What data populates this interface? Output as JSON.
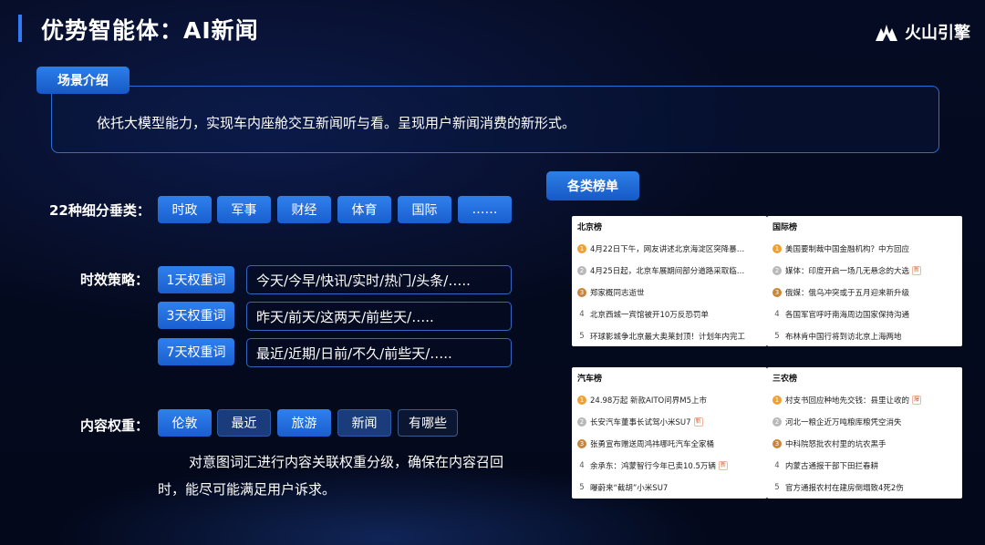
{
  "header": {
    "title": "优势智能体：AI新闻",
    "logo_text": "火山引擎"
  },
  "scene": {
    "tag": "场景介绍",
    "text": "依托大模型能力，实现车内座舱交互新闻听与看。呈现用户新闻消费的新形式。"
  },
  "categories": {
    "label": "22种细分垂类：",
    "items": [
      "时政",
      "军事",
      "财经",
      "体育",
      "国际",
      "……"
    ]
  },
  "strategy": {
    "label": "时效策略：",
    "rows": [
      {
        "tag": "1天权重词",
        "words": "今天/今早/快讯/实时/热门/头条/….."
      },
      {
        "tag": "3天权重词",
        "words": "昨天/前天/这两天/前些天/….."
      },
      {
        "tag": "7天权重词",
        "words": "最近/近期/日前/不久/前些天/….."
      }
    ]
  },
  "weight": {
    "label": "内容权重：",
    "items": [
      "伦敦",
      "最近",
      "旅游",
      "新闻",
      "有哪些"
    ],
    "description": "对意图词汇进行内容关联权重分级，确保在内容召回时，能尽可能满足用户诉求。"
  },
  "rankings": {
    "tag": "各类榜单",
    "badge_colors": [
      "#f0a030",
      "#b8b8b8",
      "#c9853a"
    ],
    "cards": [
      {
        "title": "北京榜",
        "items": [
          {
            "rank": "1",
            "text": "4月22日下午，网友讲述北京海淀区突降暴…",
            "hot": ""
          },
          {
            "rank": "2",
            "text": "4月25日起，北京车展期间部分道路采取临…",
            "hot": ""
          },
          {
            "rank": "3",
            "text": "郑家概同志逝世",
            "hot": ""
          },
          {
            "rank": "4",
            "text": "北京西城一宾馆被开10万反恐罚单",
            "hot": ""
          },
          {
            "rank": "5",
            "text": "环球影城争北京最大奥莱封顶！计划年内完工",
            "hot": ""
          }
        ]
      },
      {
        "title": "国际榜",
        "items": [
          {
            "rank": "1",
            "text": "美国要制裁中国金融机构？中方回应",
            "hot": ""
          },
          {
            "rank": "2",
            "text": "媒体：印度开启一场几无悬念的大选",
            "hot": "新"
          },
          {
            "rank": "3",
            "text": "俄媒：俄乌冲突或于五月迎来新升级",
            "hot": ""
          },
          {
            "rank": "4",
            "text": "各国军官呼吁南海周边国家保持沟通",
            "hot": ""
          },
          {
            "rank": "5",
            "text": "布林肯中国行将到访北京上海两地",
            "hot": ""
          }
        ]
      },
      {
        "title": "汽车榜",
        "items": [
          {
            "rank": "1",
            "text": "24.98万起 新款AITO问界M5上市",
            "hot": ""
          },
          {
            "rank": "2",
            "text": "长安汽车董事长试驾小米SU7",
            "hot": "新"
          },
          {
            "rank": "3",
            "text": "张勇宣布赠送周鸿祎哪吒汽车全家桶",
            "hot": ""
          },
          {
            "rank": "4",
            "text": "余承东：鸿蒙智行今年已卖10.5万辆",
            "hot": "新"
          },
          {
            "rank": "5",
            "text": "曝蔚来“截胡”小米SU7",
            "hot": ""
          }
        ]
      },
      {
        "title": "三农榜",
        "items": [
          {
            "rank": "1",
            "text": "村支书回应种地先交钱：县里让收的",
            "hot": "爆"
          },
          {
            "rank": "2",
            "text": "河北一粮企近万吨粮库粮凭空消失",
            "hot": ""
          },
          {
            "rank": "3",
            "text": "中科院怒批农村里的坑农黑手",
            "hot": ""
          },
          {
            "rank": "4",
            "text": "内蒙古通报干部下田拦春耕",
            "hot": ""
          },
          {
            "rank": "5",
            "text": "官方通报农村在建房倒塌致4死2伤",
            "hot": ""
          }
        ]
      }
    ]
  }
}
